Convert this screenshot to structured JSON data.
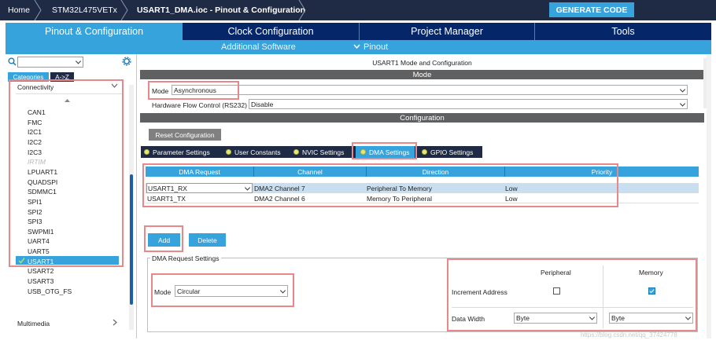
{
  "breadcrumb": [
    "Home",
    "STM32L475VETx",
    "USART1_DMA.ioc - Pinout & Configuration"
  ],
  "generate_code_label": "GENERATE CODE",
  "main_tabs": [
    "Pinout & Configuration",
    "Clock Configuration",
    "Project Manager",
    "Tools"
  ],
  "sub_tabs": {
    "additional_software": "Additional Software",
    "pinout": "Pinout"
  },
  "left_panel": {
    "category_tabs": [
      "Categories",
      "A->Z"
    ],
    "group_title": "Connectivity",
    "items": [
      "CAN1",
      "FMC",
      "I2C1",
      "I2C2",
      "I2C3",
      "IRTIM",
      "LPUART1",
      "QUADSPI",
      "SDMMC1",
      "SPI1",
      "SPI2",
      "SPI3",
      "SWPMI1",
      "UART4",
      "UART5",
      "USART1",
      "USART2",
      "USART3",
      "USB_OTG_FS"
    ],
    "disabled_item": "IRTIM",
    "selected_item": "USART1",
    "next_group": "Multimedia"
  },
  "right_panel": {
    "title": "USART1 Mode and Configuration",
    "mode_section": "Mode",
    "mode_label": "Mode",
    "mode_value": "Asynchronous",
    "hfc_label": "Hardware Flow Control (RS232)",
    "hfc_value": "Disable",
    "config_section": "Configuration",
    "reset_button": "Reset Configuration",
    "tabs": [
      "Parameter Settings",
      "User Constants",
      "NVIC Settings",
      "DMA Settings",
      "GPIO Settings"
    ],
    "active_tab": "DMA Settings"
  },
  "dma_table": {
    "headers": [
      "DMA Request",
      "Channel",
      "Direction",
      "Priority"
    ],
    "rows": [
      {
        "request": "USART1_RX",
        "channel": "DMA2 Channel 7",
        "direction": "Peripheral To Memory",
        "priority": "Low"
      },
      {
        "request": "USART1_TX",
        "channel": "DMA2 Channel 6",
        "direction": "Memory To Peripheral",
        "priority": "Low"
      }
    ]
  },
  "buttons": {
    "add": "Add",
    "delete": "Delete"
  },
  "request_settings": {
    "group_title": "DMA Request Settings",
    "mode_label": "Mode",
    "mode_value": "Circular",
    "peripheral_header": "Peripheral",
    "memory_header": "Memory",
    "increment_label": "Increment Address",
    "peripheral_increment": false,
    "memory_increment": true,
    "data_width_label": "Data Width",
    "peripheral_width": "Byte",
    "memory_width": "Byte"
  },
  "watermark": "https://blog.csdn.net/qq_37424778",
  "colors": {
    "accent": "#37a3dc",
    "nav_dark": "#05276a",
    "breadcrumb": "#1f2a44",
    "highlight": "#e8888a"
  },
  "icons": [
    "search-icon",
    "gear-icon",
    "chevron-down-icon",
    "check-icon"
  ]
}
